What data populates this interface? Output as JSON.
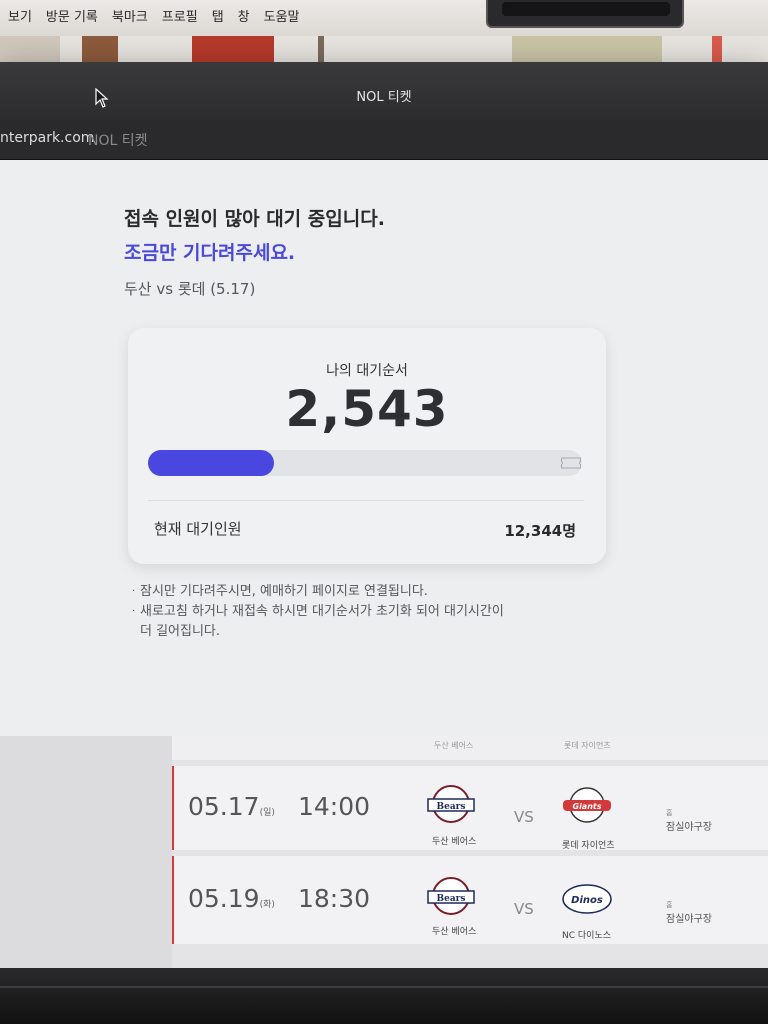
{
  "menubar": {
    "items": [
      "보기",
      "방문 기록",
      "북마크",
      "프로필",
      "탭",
      "창",
      "도움말"
    ]
  },
  "window": {
    "title": "NOL 티켓",
    "url": "nterpark.com",
    "site_name": "NOL 티켓"
  },
  "queue": {
    "headline": "접속 인원이 많아 대기 중입니다.",
    "subline": "조금만 기다려주세요.",
    "match": "두산 vs 롯데 (5.17)",
    "my_order_label": "나의 대기순서",
    "my_order": "2,543",
    "progress_fraction": 0.29,
    "current_label": "현재 대기인원",
    "current_value": "12,344명",
    "notes": [
      {
        "line1": "잠시만 기다려주시면, 예매하기 페이지로 연결됩니다.",
        "line2": ""
      },
      {
        "line1": "새로고침 하거나 재접속 하시면 대기순서가 초기화 되어 대기시간이",
        "line2": "더 길어집니다."
      }
    ]
  },
  "schedule": {
    "peek": {
      "team_a": "두산 베어스",
      "team_b": "롯데 자이언츠"
    },
    "games": [
      {
        "date": "05.17",
        "day": "(일)",
        "time": "14:00",
        "team_a": "두산 베어스",
        "vs": "VS",
        "team_b": "롯데 자이언츠",
        "venue_tag": "홈",
        "venue": "잠실야구장",
        "logo_a": "Bears",
        "logo_b": "Giants"
      },
      {
        "date": "05.19",
        "day": "(화)",
        "time": "18:30",
        "team_a": "두산 베어스",
        "vs": "VS",
        "team_b": "NC 다이노스",
        "venue_tag": "홈",
        "venue": "잠실야구장",
        "logo_a": "Bears",
        "logo_b": "Dinos"
      }
    ]
  },
  "colors": {
    "accent": "#4b49d8",
    "progress": "#4a47e0"
  },
  "icons": {
    "cursor": "cursor-arrow-icon",
    "ticket": "ticket-icon"
  }
}
